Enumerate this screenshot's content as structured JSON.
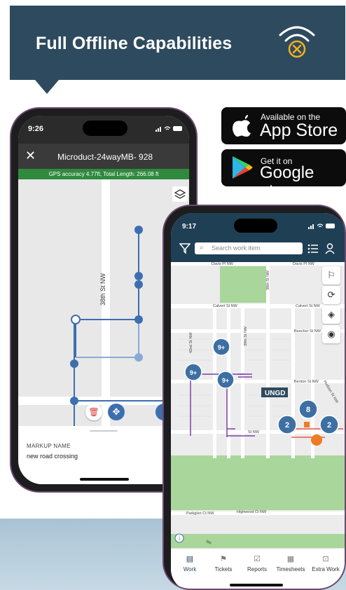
{
  "banner": {
    "title": "Full Offline Capabilities",
    "icon": "wifi-off-icon"
  },
  "badges": {
    "appstore": {
      "small": "Available on the",
      "big": "App Store",
      "icon": "apple-icon"
    },
    "googleplay": {
      "small": "Get it on",
      "big": "Google play",
      "icon": "play-icon"
    }
  },
  "phone1": {
    "time": "9:26",
    "title": "Microduct-24wayMB- 928",
    "gps": "GPS accuracy 4.77ft, Total Length: 266.08 ft",
    "street_label": "38th St NW",
    "save_partial": "Sa",
    "markup_label": "MARKUP NAME",
    "markup_value": "new road crossing",
    "colors": {
      "route": "#3d6fb0",
      "gps_bar": "#2f8a3e",
      "header": "#3a3a3a"
    }
  },
  "phone2": {
    "time": "9:17",
    "search_placeholder": "Search work item",
    "map_labels": [
      "Davis Pl NW",
      "Davis Pl NW",
      "Calvert St NW",
      "Calvert St NW",
      "Beecher St NW",
      "Benton St NW",
      "St NW",
      "Parkglen Ct NW",
      "Highwood Ct NW",
      "42nd St NW",
      "39th St NW",
      "38th St NW",
      "Hudson St NW",
      "Ma"
    ],
    "ugnd_label": "UNGD",
    "clusters": [
      "9+",
      "9+",
      "9+",
      "8",
      "2",
      "2"
    ],
    "nav": [
      {
        "label": "Work",
        "icon": "clipboard-icon"
      },
      {
        "label": "Tickets",
        "icon": "flag-icon"
      },
      {
        "label": "Reports",
        "icon": "report-icon"
      },
      {
        "label": "Timesheets",
        "icon": "calendar-icon"
      },
      {
        "label": "Extra Work",
        "icon": "extra-work-icon"
      }
    ],
    "colors": {
      "header": "#1f3f55",
      "cluster": "#3d6fa3",
      "park": "#a9d69a",
      "marker": "#f07a22"
    }
  }
}
